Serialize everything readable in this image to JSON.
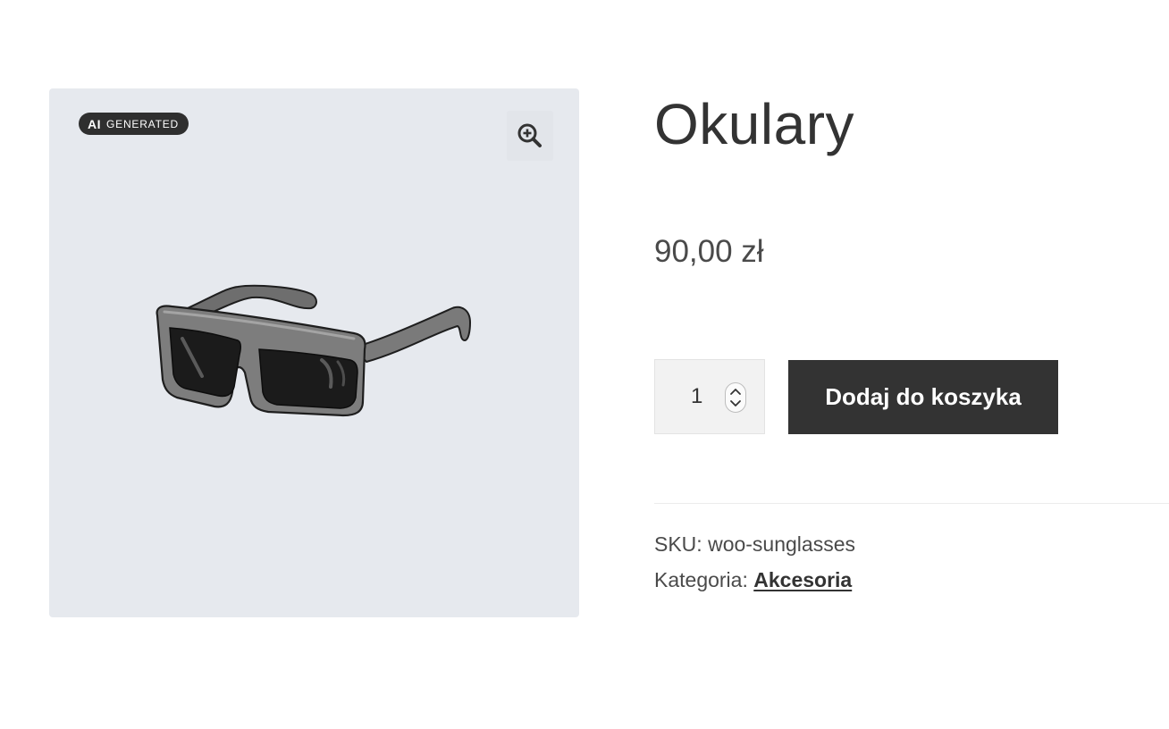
{
  "gallery": {
    "badge_ai": "AI",
    "badge_generated": "GENERATED",
    "zoom_icon": "zoom-in-magnifier",
    "image_subject": "sunglasses-icon"
  },
  "product": {
    "title": "Okulary",
    "price": "90,00 zł",
    "quantity": "1",
    "add_to_cart_label": "Dodaj do koszyka"
  },
  "meta": {
    "sku_label": "SKU:",
    "sku_value": "woo-sunglasses",
    "category_label": "Kategoria:",
    "category_value": "Akcesoria"
  },
  "colors": {
    "button_bg": "#333333",
    "gallery_bg": "#e6e9ee",
    "badge_bg": "#2f2f2f"
  }
}
